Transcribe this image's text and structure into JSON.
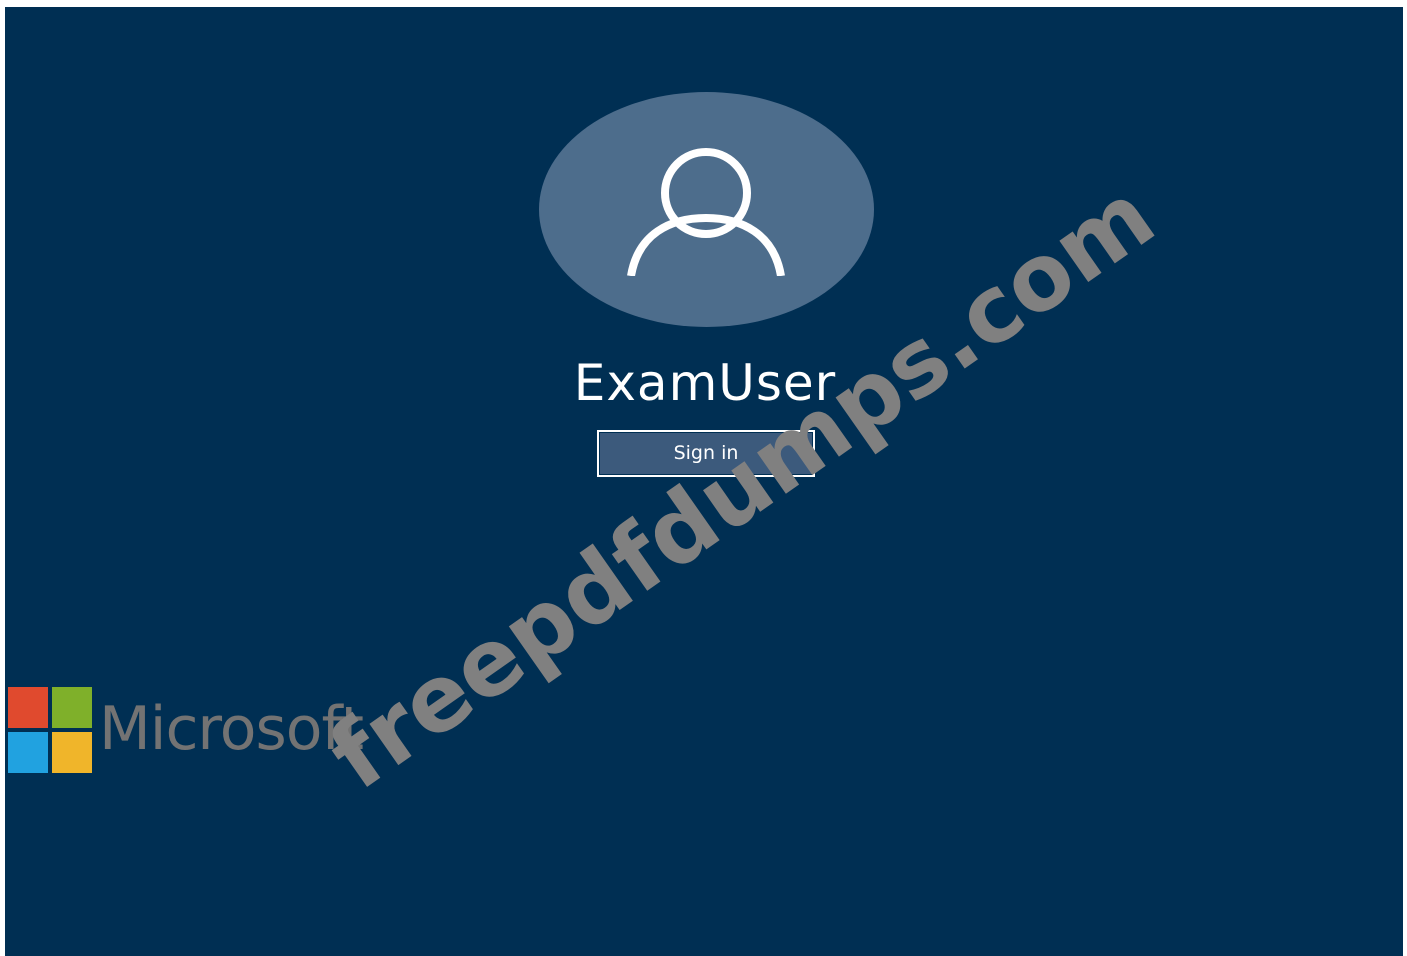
{
  "lock_screen": {
    "username": "ExamUser",
    "sign_in_label": "Sign in",
    "avatar_icon": "user-icon",
    "colors": {
      "background": "#002f53",
      "avatar_circle": "#4d6d8c",
      "button_fill": "#3c5a7c"
    }
  },
  "branding": {
    "logo_text": "Microsoft",
    "logo_icon": "microsoft-logo-icon"
  },
  "watermark": {
    "text": "freepdfdumps.com"
  }
}
